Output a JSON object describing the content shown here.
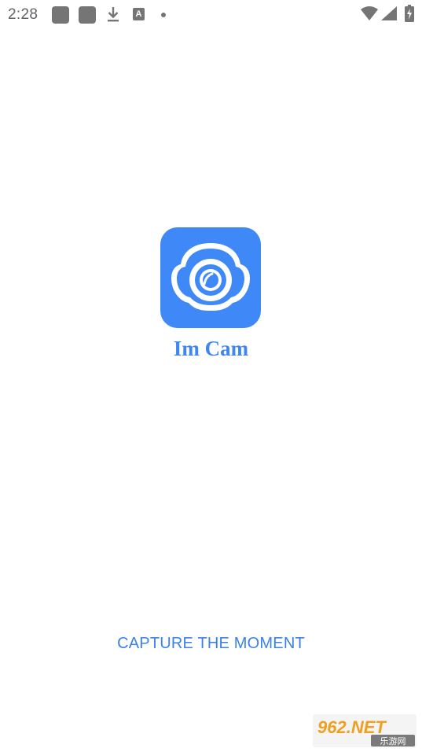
{
  "status_bar": {
    "time": "2:28",
    "notification_icons": [
      "app-square-icon",
      "app-square-icon",
      "download-icon",
      "a-icon",
      "dot-icon"
    ],
    "system_icons": [
      "wifi-icon",
      "signal-icon",
      "battery-icon"
    ],
    "a_icon_letter": "A"
  },
  "splash": {
    "app_name": "Im Cam",
    "tagline": "CAPTURE THE MOMENT",
    "accent_color": "#3f88f8"
  },
  "watermark": {
    "brand": "962.NET",
    "subtitle": "乐游网"
  }
}
